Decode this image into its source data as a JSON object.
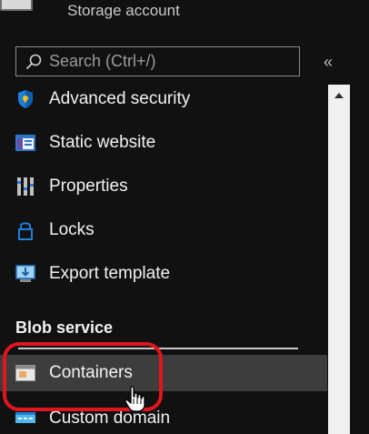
{
  "header": {
    "subtitle": "Storage account"
  },
  "search": {
    "placeholder": "Search (Ctrl+/)",
    "value": ""
  },
  "collapse": {
    "label": "«"
  },
  "nav": {
    "items": [
      {
        "label": "Advanced security",
        "icon": "shield-icon"
      },
      {
        "label": "Static website",
        "icon": "static-website-icon"
      },
      {
        "label": "Properties",
        "icon": "properties-icon"
      },
      {
        "label": "Locks",
        "icon": "lock-icon"
      },
      {
        "label": "Export template",
        "icon": "export-template-icon"
      }
    ],
    "section_header": "Blob service",
    "section_items": [
      {
        "label": "Containers",
        "icon": "containers-icon",
        "selected": true
      },
      {
        "label": "Custom domain",
        "icon": "custom-domain-icon"
      }
    ]
  },
  "colors": {
    "background": "#111111",
    "selected_row": "#3d3d3d",
    "annotation": "#e0151d",
    "accent_blue": "#1e7fd8"
  }
}
